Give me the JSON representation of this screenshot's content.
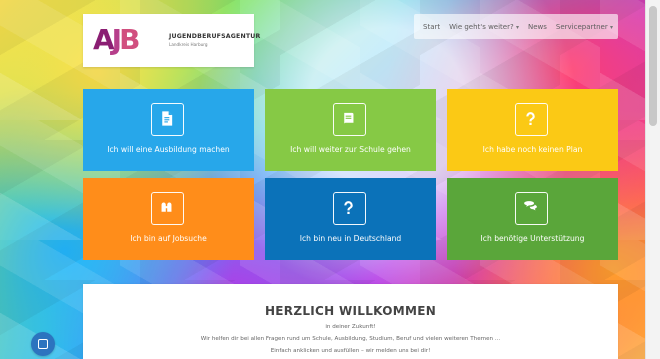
{
  "logo": {
    "mark_a": "A",
    "mark_j": "J",
    "mark_b": "B",
    "title": "JUGENDBERUFSAGENTUR",
    "subtitle": "Landkreis Harburg"
  },
  "nav": {
    "items": [
      {
        "label": "Start"
      },
      {
        "label": "Wie geht's weiter?"
      },
      {
        "label": "News"
      },
      {
        "label": "Servicepartner"
      }
    ],
    "caret": "▾"
  },
  "tiles": [
    {
      "label": "Ich will eine Ausbildung machen",
      "color": "#27a7ea",
      "icon": "document-icon"
    },
    {
      "label": "Ich will weiter zur Schule gehen",
      "color": "#86c945",
      "icon": "book-icon"
    },
    {
      "label": "Ich habe noch keinen Plan",
      "color": "#fbc915",
      "icon": "question-icon"
    },
    {
      "label": "Ich bin auf Jobsuche",
      "color": "#ff8d1a",
      "icon": "binoculars-icon"
    },
    {
      "label": "Ich bin neu in Deutschland",
      "color": "#0b72b9",
      "icon": "question-icon"
    },
    {
      "label": "Ich benötige Unterstützung",
      "color": "#5aa63a",
      "icon": "chat-icon"
    }
  ],
  "welcome": {
    "title": "HERZLICH WILLKOMMEN",
    "line1": "in deiner Zukunft!",
    "line2": "Wir helfen dir bei allen Fragen rund um Schule, Ausbildung, Studium, Beruf und vielen weiteren Themen ...",
    "line3": "Einfach anklicken und ausfüllen – wir melden uns bei dir!"
  }
}
